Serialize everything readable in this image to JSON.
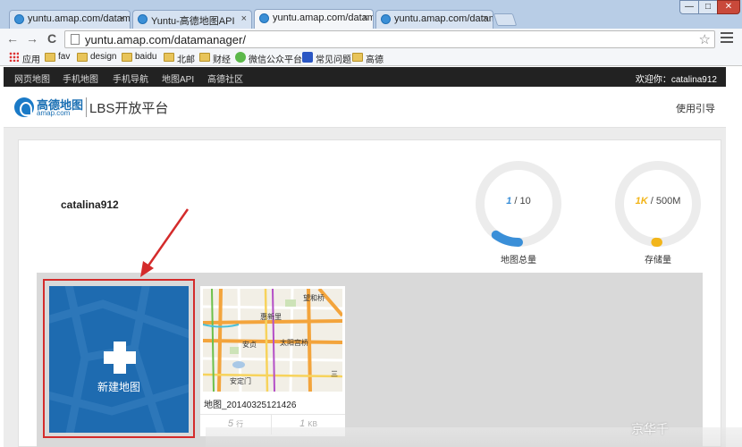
{
  "browser": {
    "tabs": [
      {
        "title": "yuntu.amap.com/datam",
        "active": false
      },
      {
        "title": "Yuntu-高德地图API",
        "active": false
      },
      {
        "title": "yuntu.amap.com/datam",
        "active": true
      },
      {
        "title": "yuntu.amap.com/datam",
        "active": false
      }
    ],
    "tab_close": "×",
    "window_controls": {
      "minimize": "—",
      "maximize": "□",
      "close": "✕"
    },
    "url": "yuntu.amap.com/datamanager/",
    "nav": {
      "back": "←",
      "forward": "→",
      "reload": "C"
    },
    "star": "☆",
    "bookmarks": [
      {
        "label": "应用",
        "icon": "apps-icon"
      },
      {
        "label": "fav",
        "icon": "folder-icon"
      },
      {
        "label": "design",
        "icon": "folder-icon"
      },
      {
        "label": "baidu",
        "icon": "folder-icon"
      },
      {
        "label": "北邮",
        "icon": "folder-icon"
      },
      {
        "label": "财经",
        "icon": "folder-icon"
      },
      {
        "label": "微信公众平台",
        "icon": "wechat-icon"
      },
      {
        "label": "常见问题",
        "icon": "paw-icon"
      },
      {
        "label": "高德",
        "icon": "folder-icon"
      }
    ]
  },
  "site_nav": {
    "items": [
      "网页地图",
      "手机地图",
      "手机导航",
      "地图API",
      "高德社区"
    ],
    "welcome": "欢迎你：catalina912"
  },
  "header": {
    "logo_cn": "高德地图",
    "logo_en": "amap.com",
    "logo_product": "LBS开放平台",
    "guide": "使用引导"
  },
  "dashboard": {
    "username": "catalina912",
    "map_total": {
      "used": "1",
      "limit": " / 10",
      "label": "地图总量",
      "fraction": 0.1,
      "color": "#3a8fd8"
    },
    "storage": {
      "used": "1K",
      "limit": " / 500M",
      "label": "存储量",
      "fraction": 0.002,
      "color": "#f2b51a"
    }
  },
  "maps": {
    "new_map_label": "新建地图",
    "items": [
      {
        "name": "地图_20140325121426",
        "rows": "5",
        "rows_unit": "行",
        "size": "1",
        "size_unit": "KB",
        "thumb_labels": [
          "望和桥",
          "惠新里",
          "安贞",
          "太阳宫桥",
          "安定门",
          "三"
        ]
      }
    ]
  },
  "watermark": "京华千"
}
